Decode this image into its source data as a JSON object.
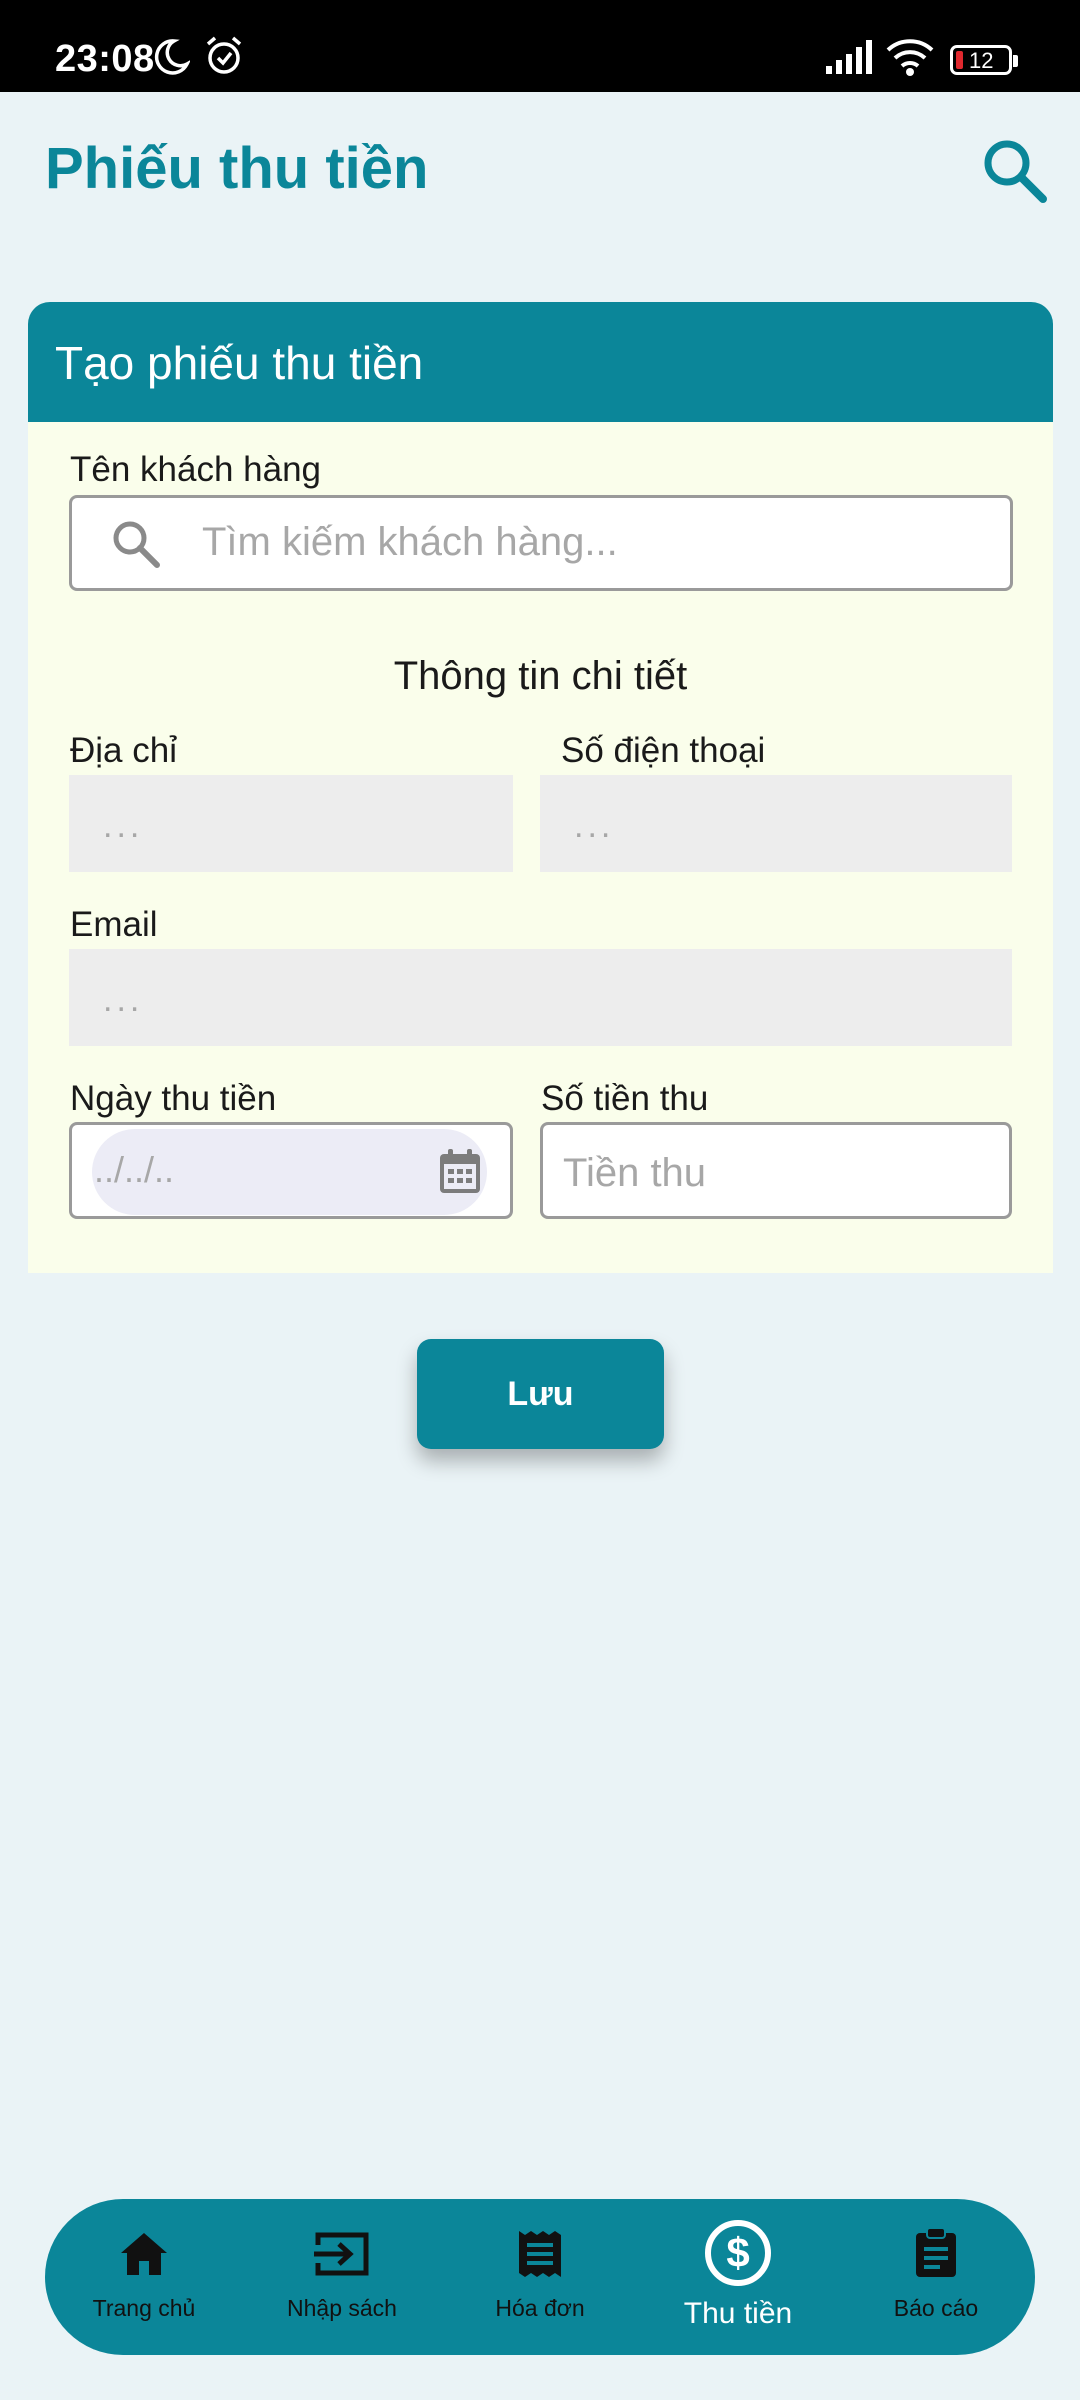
{
  "status_bar": {
    "time": "23:08",
    "battery_level": "12"
  },
  "header": {
    "title": "Phiếu thu tiền"
  },
  "form": {
    "card_title": "Tạo phiếu thu tiền",
    "customer_name_label": "Tên khách hàng",
    "customer_search_placeholder": "Tìm kiếm khách hàng...",
    "details_title": "Thông tin chi tiết",
    "address_label": "Địa chỉ",
    "address_value": "...",
    "phone_label": "Số điện thoại",
    "phone_value": "...",
    "email_label": "Email",
    "email_value": "...",
    "date_label": "Ngày thu tiền",
    "date_placeholder": "../../..",
    "amount_label": "Số tiền thu",
    "amount_placeholder": "Tiền thu"
  },
  "actions": {
    "save_label": "Lưu"
  },
  "bottom_nav": {
    "items": [
      {
        "label": "Trang chủ",
        "icon": "home-icon"
      },
      {
        "label": "Nhập sách",
        "icon": "import-icon"
      },
      {
        "label": "Hóa đơn",
        "icon": "receipt-icon"
      },
      {
        "label": "Thu tiền",
        "icon": "dollar-circle-icon",
        "active": true
      },
      {
        "label": "Báo cáo",
        "icon": "clipboard-icon"
      }
    ]
  },
  "colors": {
    "primary": "#0b8699",
    "background": "#eaf3f6",
    "card_body": "#fafeeb"
  }
}
